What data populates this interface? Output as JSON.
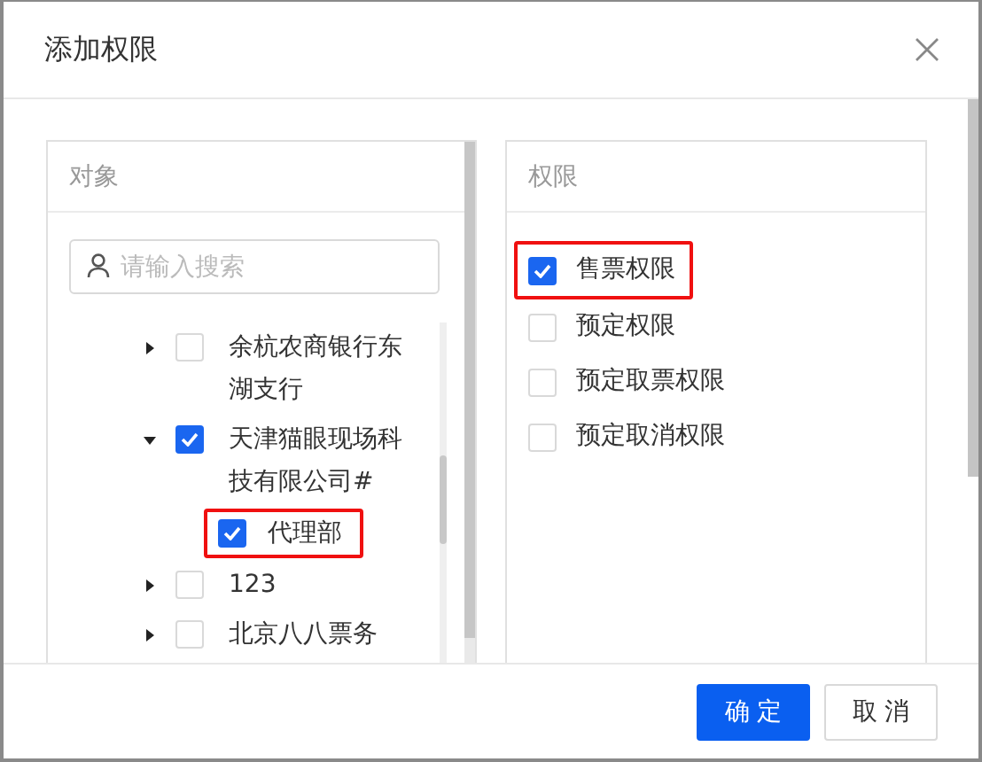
{
  "dialog": {
    "title": "添加权限"
  },
  "objects_panel": {
    "title": "对象",
    "search": {
      "placeholder": "请输入搜索"
    },
    "tree": [
      {
        "label": "余杭农商银行东湖支行",
        "kind": "branch",
        "expanded": false,
        "checked": false,
        "highlighted": false
      },
      {
        "label": "天津猫眼现场科技有限公司#",
        "kind": "branch",
        "expanded": true,
        "checked": true,
        "highlighted": false,
        "children": [
          {
            "label": "代理部",
            "kind": "leaf",
            "checked": true,
            "highlighted": true
          }
        ]
      },
      {
        "label": "123",
        "kind": "branch",
        "expanded": false,
        "checked": false,
        "highlighted": false
      },
      {
        "label": "北京八八票务",
        "kind": "branch",
        "expanded": false,
        "checked": false,
        "highlighted": false
      }
    ]
  },
  "permissions_panel": {
    "title": "权限",
    "items": [
      {
        "label": "售票权限",
        "checked": true,
        "highlighted": true
      },
      {
        "label": "预定权限",
        "checked": false,
        "highlighted": false
      },
      {
        "label": "预定取票权限",
        "checked": false,
        "highlighted": false
      },
      {
        "label": "预定取消权限",
        "checked": false,
        "highlighted": false
      }
    ]
  },
  "buttons": [
    {
      "label": "确 定",
      "kind": "primary"
    },
    {
      "label": "取 消",
      "kind": "default"
    }
  ]
}
